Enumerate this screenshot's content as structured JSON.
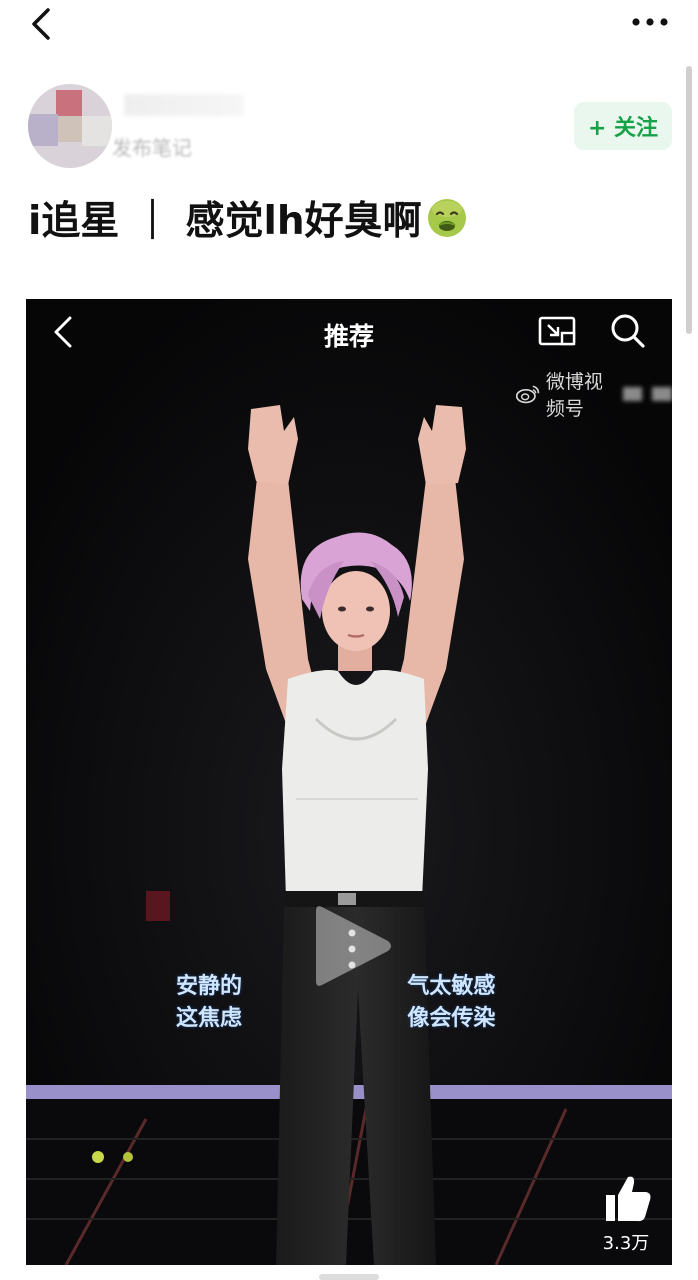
{
  "topbar": {
    "back_icon": "chevron-left-icon",
    "more_icon": "more-dots-icon"
  },
  "author": {
    "follow_label": "+ 关注",
    "sub_label": "发布笔记"
  },
  "post": {
    "title_text": "i追星 ｜ 感觉lh好臭啊",
    "emoji": "nauseated-face-emoji"
  },
  "video": {
    "header_title": "推荐",
    "watermark": "微博视频号",
    "subtitle_line1_left": "安静的",
    "subtitle_line1_right": "气太敏感",
    "subtitle_line2_left": "这焦虑",
    "subtitle_line2_right": "像会传染",
    "like_count": "3.3万",
    "icons": [
      "chevron-left-icon",
      "cast-screen-icon",
      "search-icon",
      "weibo-logo-icon",
      "play-icon",
      "thumbs-up-icon"
    ]
  },
  "colors": {
    "accent_green": "#19a14a",
    "follow_bg": "#e9f7ee",
    "hair_pink": "#d9a3d6"
  }
}
